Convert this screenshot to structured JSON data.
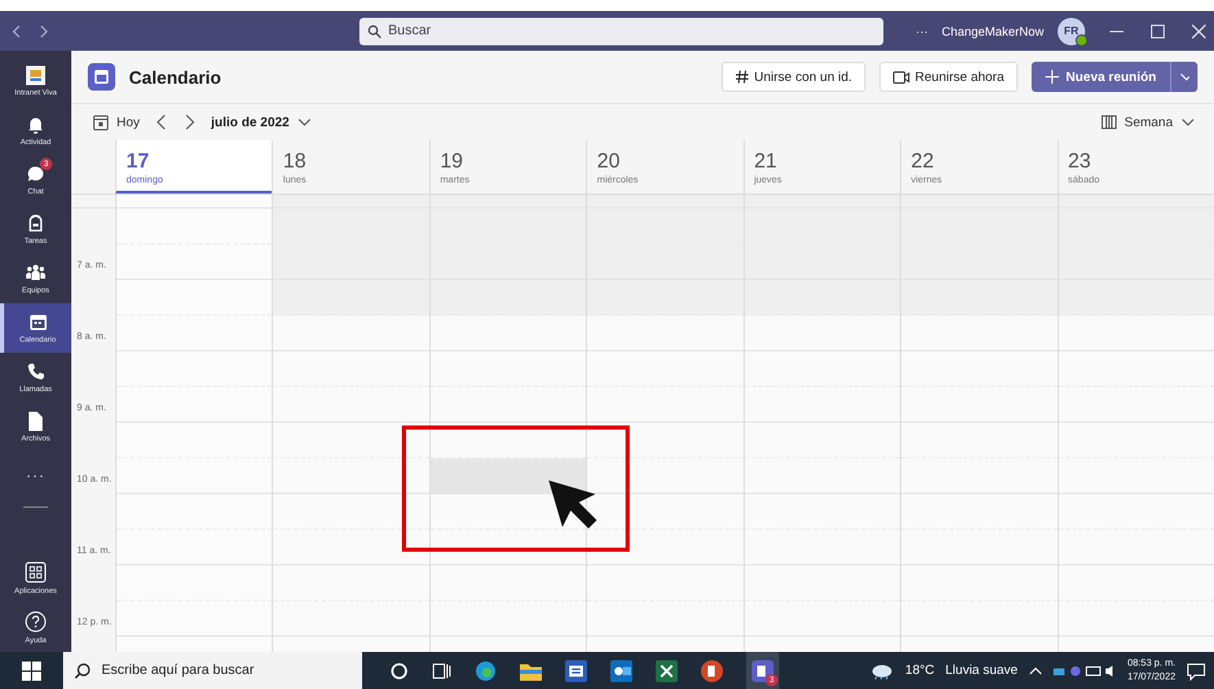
{
  "title_bar": {
    "search_placeholder": "Buscar",
    "more": "···",
    "org": "ChangeMakerNow",
    "avatar": "FR"
  },
  "rail": [
    {
      "label": "Intranet Viva",
      "selected": false
    },
    {
      "label": "Actividad",
      "selected": false
    },
    {
      "label": "Chat",
      "selected": false,
      "badge": "3"
    },
    {
      "label": "Tareas",
      "selected": false
    },
    {
      "label": "Equipos",
      "selected": false
    },
    {
      "label": "Calendario",
      "selected": true
    },
    {
      "label": "Llamadas",
      "selected": false
    },
    {
      "label": "Archivos",
      "selected": false
    },
    {
      "label": "···",
      "selected": false
    }
  ],
  "rail_bottom": [
    {
      "label": "Aplicaciones"
    },
    {
      "label": "Ayuda"
    }
  ],
  "header": {
    "title": "Calendario",
    "join_button": "Unirse con un id.",
    "meet_button": "Reunirse ahora",
    "new_button": "Nueva reunión"
  },
  "toolbar": {
    "today": "Hoy",
    "month": "julio de 2022",
    "view": "Semana"
  },
  "days": [
    {
      "number": "17",
      "name": "domingo",
      "selected": true
    },
    {
      "number": "18",
      "name": "lunes",
      "selected": false
    },
    {
      "number": "19",
      "name": "martes",
      "selected": false
    },
    {
      "number": "20",
      "name": "miércoles",
      "selected": false
    },
    {
      "number": "21",
      "name": "jueves",
      "selected": false
    },
    {
      "number": "22",
      "name": "viernes",
      "selected": false
    },
    {
      "number": "23",
      "name": "sábado",
      "selected": false
    }
  ],
  "hours": [
    "7 a. m.",
    "8 a. m.",
    "9 a. m.",
    "10 a. m.",
    "11 a. m.",
    "12 p. m."
  ],
  "taskbar": {
    "search_placeholder": "Escribe aquí para buscar",
    "teams_badge": "3",
    "weather": "18°C",
    "weather_text": "Lluvia suave",
    "time": "08:53 p. m.",
    "date": "17/07/2022"
  }
}
